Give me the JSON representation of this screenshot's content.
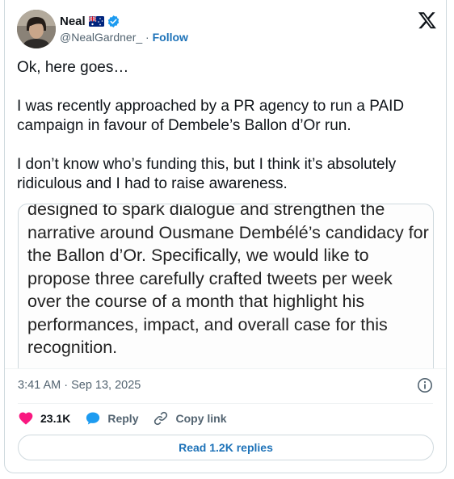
{
  "author": {
    "display_name": "Neal",
    "handle": "@NealGardner_",
    "separator": "·",
    "follow_label": "Follow"
  },
  "tweet": {
    "paragraphs": [
      "Ok, here goes…",
      "I was recently approached by a PR agency to run a PAID campaign in favour of Dembele’s Ballon d’Or run.",
      "I don’t know who’s funding this, but I think it’s absolutely ridiculous and I had to raise awareness."
    ]
  },
  "media": {
    "text": "designed to spark dialogue and strengthen the narrative around Ousmane Dembélé’s candidacy for the Ballon d’Or. Specifically, we would like to propose three carefully crafted tweets per week over the course of a month that highlight his performances, impact, and overall case for this recognition."
  },
  "meta": {
    "timestamp": "3:41 AM · Sep 13, 2025"
  },
  "actions": {
    "likes": "23.1K",
    "reply_label": "Reply",
    "copy_label": "Copy link"
  },
  "footer": {
    "read_replies": "Read 1.2K replies"
  },
  "colors": {
    "like": "#f91880",
    "reply": "#1d9bf0",
    "link": "#1d72b8",
    "verified": "#1d9bf0"
  },
  "icons": [
    "verified-icon",
    "australia-flag-icon",
    "x-logo-icon",
    "info-icon",
    "heart-icon",
    "reply-bubble-icon",
    "link-icon"
  ]
}
